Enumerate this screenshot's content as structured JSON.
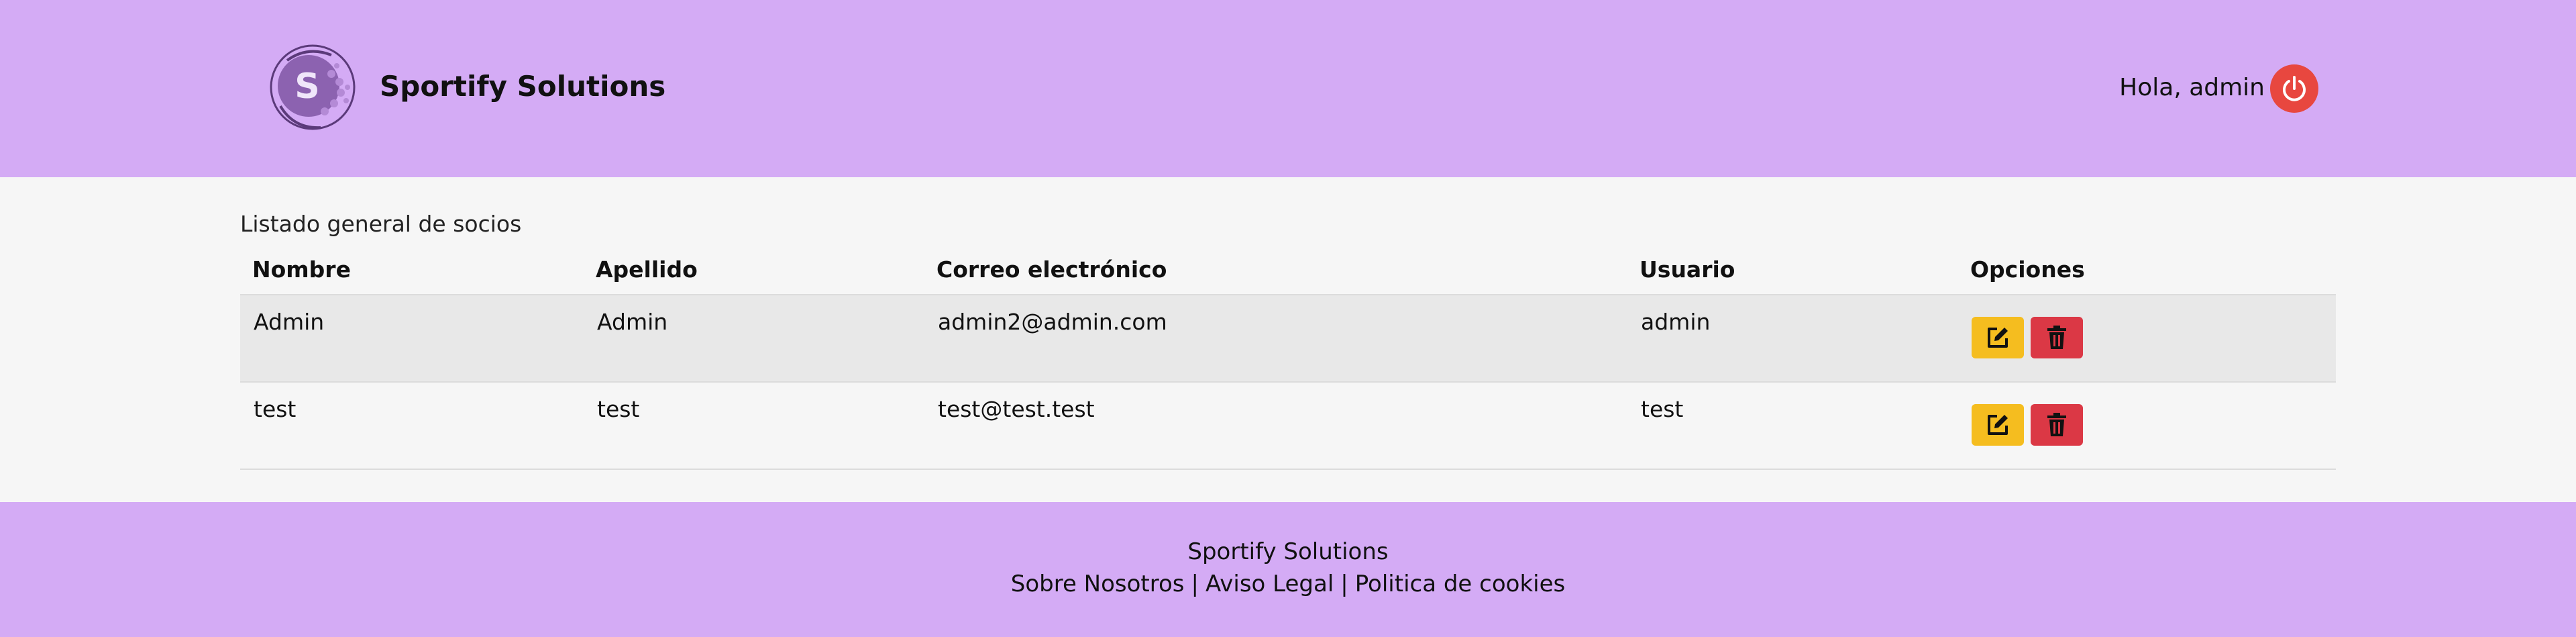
{
  "header": {
    "brand": "Sportify Solutions",
    "greeting": "Hola, admin",
    "logo_icon": "sportify-logo",
    "logout_icon": "power-icon"
  },
  "main": {
    "title": "Listado general de socios",
    "columns": {
      "nombre": "Nombre",
      "apellido": "Apellido",
      "correo": "Correo electrónico",
      "usuario": "Usuario",
      "opciones": "Opciones"
    },
    "rows": [
      {
        "nombre": "Admin",
        "apellido": "Admin",
        "correo": "admin2@admin.com",
        "usuario": "admin"
      },
      {
        "nombre": "test",
        "apellido": "test",
        "correo": "test@test.test",
        "usuario": "test"
      }
    ]
  },
  "footer": {
    "name": "Sportify Solutions",
    "links": [
      "Sobre Nosotros",
      "Aviso Legal",
      "Politica de cookies"
    ],
    "separator": "|"
  },
  "colors": {
    "header_bg": "#d4abf5",
    "edit_button": "#f5bd1f",
    "delete_button": "#db3845",
    "logout_button": "#e8473f"
  }
}
